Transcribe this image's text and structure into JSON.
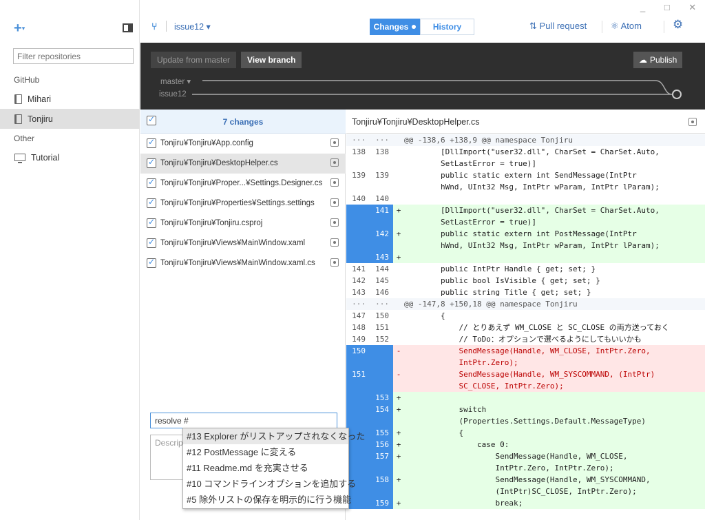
{
  "window": {
    "controls": "_ □ ✕"
  },
  "sidebar": {
    "add_label": "+",
    "filter_placeholder": "Filter repositories",
    "groups": [
      {
        "label": "GitHub",
        "repos": [
          "Mihari",
          "Tonjiru"
        ]
      },
      {
        "label": "Other",
        "repos": [
          "Tutorial"
        ]
      }
    ],
    "selected_repo": "Tonjiru"
  },
  "topbar": {
    "branch": "issue12 ▾",
    "tab_changes": "Changes",
    "tab_history": "History",
    "pull_request": "Pull request",
    "atom": "Atom"
  },
  "branchbar": {
    "update_from_master": "Update from master",
    "view_branch": "View branch",
    "publish": "Publish",
    "master_label": "master ▾",
    "branch_label": "issue12"
  },
  "changes": {
    "count_label": "7 changes",
    "files": [
      "Tonjiru¥Tonjiru¥App.config",
      "Tonjiru¥Tonjiru¥DesktopHelper.cs",
      "Tonjiru¥Tonjiru¥Proper...¥Settings.Designer.cs",
      "Tonjiru¥Tonjiru¥Properties¥Settings.settings",
      "Tonjiru¥Tonjiru¥Tonjiru.csproj",
      "Tonjiru¥Tonjiru¥Views¥MainWindow.xaml",
      "Tonjiru¥Tonjiru¥Views¥MainWindow.xaml.cs"
    ],
    "selected_file_index": 1,
    "summary_value": "resolve #",
    "description_placeholder": "Descript"
  },
  "autocomplete": [
    "#13 Explorer がリストアップされなくなった",
    "#12 PostMessage に変える",
    "#11 Readme.md を充実させる",
    "#10 コマンドラインオプションを追加する",
    "#5 除外リストの保存を明示的に行う機能"
  ],
  "diff": {
    "path": "Tonjiru¥Tonjiru¥DesktopHelper.cs",
    "lines": [
      {
        "t": "hunk",
        "o": "···",
        "n": "···",
        "s": "",
        "c": "@@ -138,6 +138,9 @@ namespace Tonjiru"
      },
      {
        "t": "ctx",
        "o": "138",
        "n": "138",
        "s": "",
        "c": "        [DllImport(\"user32.dll\", CharSet = CharSet.Auto,"
      },
      {
        "t": "ctx",
        "o": "",
        "n": "",
        "s": "",
        "c": "        SetLastError = true)]"
      },
      {
        "t": "ctx",
        "o": "139",
        "n": "139",
        "s": "",
        "c": "        public static extern int SendMessage(IntPtr"
      },
      {
        "t": "ctx",
        "o": "",
        "n": "",
        "s": "",
        "c": "        hWnd, UInt32 Msg, IntPtr wParam, IntPtr lParam);"
      },
      {
        "t": "ctx",
        "o": "140",
        "n": "140",
        "s": "",
        "c": ""
      },
      {
        "t": "add",
        "o": "",
        "n": "141",
        "s": "+",
        "c": "        [DllImport(\"user32.dll\", CharSet = CharSet.Auto,"
      },
      {
        "t": "add",
        "o": "",
        "n": "",
        "s": "",
        "c": "        SetLastError = true)]"
      },
      {
        "t": "add",
        "o": "",
        "n": "142",
        "s": "+",
        "c": "        public static extern int PostMessage(IntPtr"
      },
      {
        "t": "add",
        "o": "",
        "n": "",
        "s": "",
        "c": "        hWnd, UInt32 Msg, IntPtr wParam, IntPtr lParam);"
      },
      {
        "t": "add",
        "o": "",
        "n": "143",
        "s": "+",
        "c": ""
      },
      {
        "t": "ctx",
        "o": "141",
        "n": "144",
        "s": "",
        "c": "        public IntPtr Handle { get; set; }"
      },
      {
        "t": "ctx",
        "o": "142",
        "n": "145",
        "s": "",
        "c": "        public bool IsVisible { get; set; }"
      },
      {
        "t": "ctx",
        "o": "143",
        "n": "146",
        "s": "",
        "c": "        public string Title { get; set; }"
      },
      {
        "t": "hunk",
        "o": "···",
        "n": "···",
        "s": "",
        "c": "@@ -147,8 +150,18 @@ namespace Tonjiru"
      },
      {
        "t": "ctx",
        "o": "147",
        "n": "150",
        "s": "",
        "c": "        {"
      },
      {
        "t": "ctx",
        "o": "148",
        "n": "151",
        "s": "",
        "c": "            // とりあえず WM_CLOSE と SC_CLOSE の両方送っておく"
      },
      {
        "t": "ctx",
        "o": "149",
        "n": "152",
        "s": "",
        "c": "            // ToDo：オプションで選べるようにしてもいいかも"
      },
      {
        "t": "del",
        "o": "150",
        "n": "",
        "s": "-",
        "c": "            SendMessage(Handle, WM_CLOSE, IntPtr.Zero,"
      },
      {
        "t": "del",
        "o": "",
        "n": "",
        "s": "",
        "c": "            IntPtr.Zero);"
      },
      {
        "t": "del",
        "o": "151",
        "n": "",
        "s": "-",
        "c": "            SendMessage(Handle, WM_SYSCOMMAND, (IntPtr)"
      },
      {
        "t": "del",
        "o": "",
        "n": "",
        "s": "",
        "c": "            SC_CLOSE, IntPtr.Zero);"
      },
      {
        "t": "add",
        "o": "",
        "n": "",
        "s": "",
        "c": ""
      },
      {
        "t": "add",
        "o": "",
        "n": "153",
        "s": "+",
        "c": ""
      },
      {
        "t": "add",
        "o": "",
        "n": "154",
        "s": "+",
        "c": "            switch"
      },
      {
        "t": "add",
        "o": "",
        "n": "",
        "s": "",
        "c": "            (Properties.Settings.Default.MessageType)"
      },
      {
        "t": "add",
        "o": "",
        "n": "155",
        "s": "+",
        "c": "            {"
      },
      {
        "t": "add",
        "o": "",
        "n": "156",
        "s": "+",
        "c": "                case 0:"
      },
      {
        "t": "add",
        "o": "",
        "n": "157",
        "s": "+",
        "c": "                    SendMessage(Handle, WM_CLOSE,"
      },
      {
        "t": "add",
        "o": "",
        "n": "",
        "s": "",
        "c": "                    IntPtr.Zero, IntPtr.Zero);"
      },
      {
        "t": "add",
        "o": "",
        "n": "158",
        "s": "+",
        "c": "                    SendMessage(Handle, WM_SYSCOMMAND,"
      },
      {
        "t": "add",
        "o": "",
        "n": "",
        "s": "",
        "c": "                    (IntPtr)SC_CLOSE, IntPtr.Zero);"
      },
      {
        "t": "add",
        "o": "",
        "n": "159",
        "s": "+",
        "c": "                    break;"
      }
    ]
  },
  "colors": {
    "accent": "#3f8ee5",
    "added_bg": "#e6ffe6",
    "deleted_bg": "#ffe6e6",
    "dark_bar": "#2f2f2f"
  },
  "icons": [
    "plus-icon",
    "sidebar-toggle-icon",
    "book-icon",
    "monitor-icon",
    "branch-icon",
    "pull-request-icon",
    "atom-icon",
    "gear-icon",
    "cloud-upload-icon",
    "checkbox-icon",
    "modified-file-icon"
  ]
}
